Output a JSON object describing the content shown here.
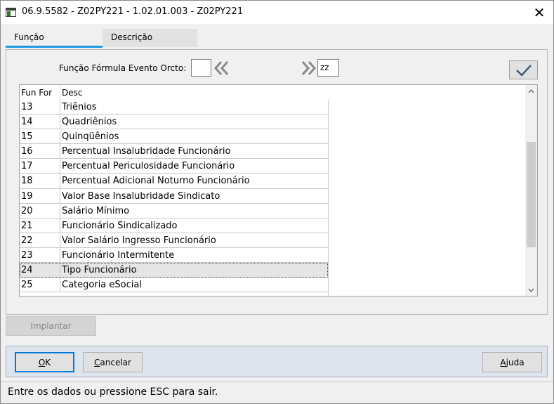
{
  "window": {
    "title": "06.9.5582 - Z02PY221 - 1.02.01.003 - Z02PY221",
    "close_glyph": "✕"
  },
  "tabs": [
    {
      "label": "Função",
      "active": true
    },
    {
      "label": "Descrição",
      "active": false
    }
  ],
  "filter": {
    "label": "Função Fórmula Evento Orcto:",
    "from_value": "",
    "to_value": "zz",
    "prev_icon": "double-chevron-left-icon",
    "next_icon": "double-chevron-right-icon",
    "confirm_icon": "checkmark-icon"
  },
  "grid": {
    "columns": [
      "Fun For",
      "Desc"
    ],
    "rows": [
      {
        "code": "13",
        "desc": "Triênios"
      },
      {
        "code": "14",
        "desc": "Quadriênios"
      },
      {
        "code": "15",
        "desc": "Quinqüênios"
      },
      {
        "code": "16",
        "desc": "Percentual Insalubridade Funcionário"
      },
      {
        "code": "17",
        "desc": "Percentual Periculosidade Funcionário"
      },
      {
        "code": "18",
        "desc": "Percentual Adicional Noturno Funcionário"
      },
      {
        "code": "19",
        "desc": "Valor Base Insalubridade Sindicato"
      },
      {
        "code": "20",
        "desc": "Salário Mínimo"
      },
      {
        "code": "21",
        "desc": "Funcionário Sindicalizado"
      },
      {
        "code": "22",
        "desc": "Valor Salário Ingresso Funcionário"
      },
      {
        "code": "23",
        "desc": "Funcionário Intermitente"
      },
      {
        "code": "24",
        "desc": "Tipo Funcionário"
      },
      {
        "code": "25",
        "desc": "Categoria eSocial"
      }
    ],
    "selected_code": "24",
    "scroll_position": 0.55
  },
  "buttons": {
    "implantar": "Implantar",
    "ok_key": "O",
    "ok_rest": "K",
    "cancel_key": "C",
    "cancel_rest": "ancelar",
    "help_key": "A",
    "help_rest": "juda"
  },
  "status": {
    "text": "Entre os dados ou pressione ESC para sair."
  },
  "colors": {
    "accent": "#1e9be0",
    "nav_arrow": "#8a8a8a",
    "checkmark": "#3d5a73",
    "footer_bg": "#dde4ee"
  }
}
